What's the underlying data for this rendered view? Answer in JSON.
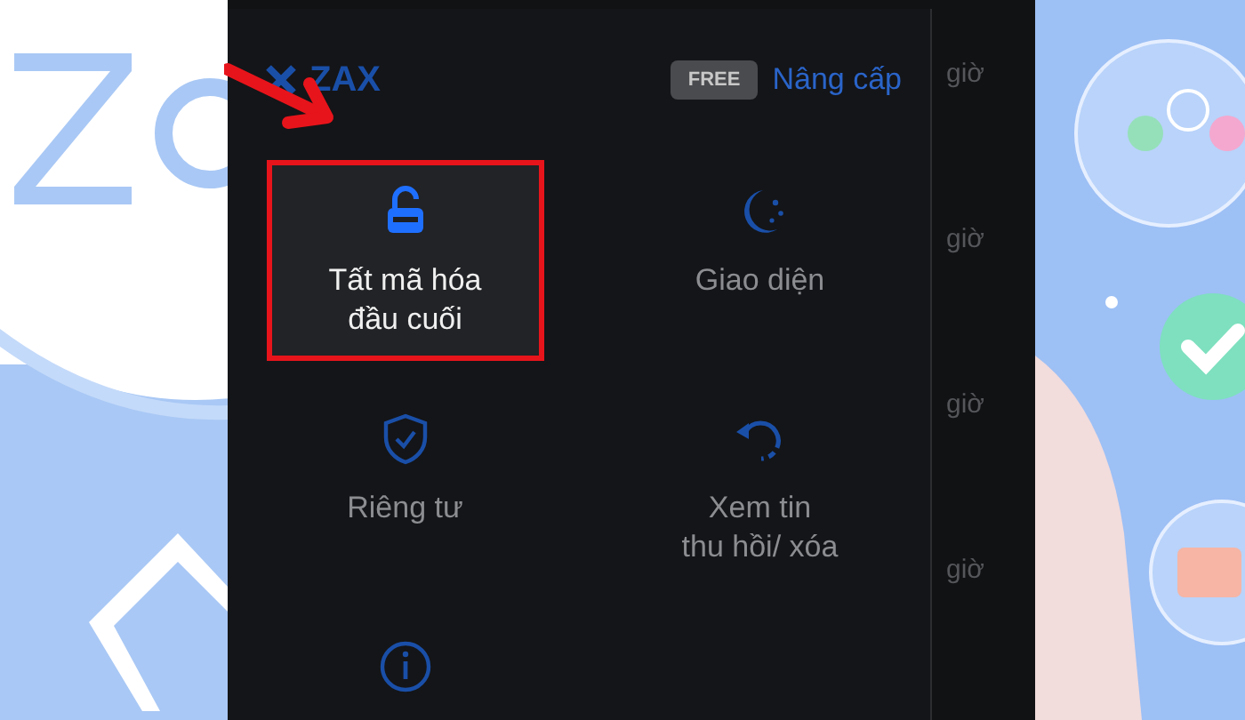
{
  "menu": {
    "logo": "ZAX",
    "plan_badge": "FREE",
    "upgrade_link": "Nâng cấp",
    "items": [
      {
        "kind": "lock",
        "label": "Tất mã hóa\nđầu cuối",
        "highlighted": true
      },
      {
        "kind": "moon",
        "label": "Giao diện",
        "highlighted": false
      },
      {
        "kind": "shield",
        "label": "Riêng tư",
        "highlighted": false
      },
      {
        "kind": "undo",
        "label": "Xem tin\nthu hồi/ xóa",
        "highlighted": false
      },
      {
        "kind": "info",
        "highlighted": false
      }
    ]
  },
  "side_times": [
    "giờ",
    "giờ",
    "giờ",
    "giờ"
  ]
}
